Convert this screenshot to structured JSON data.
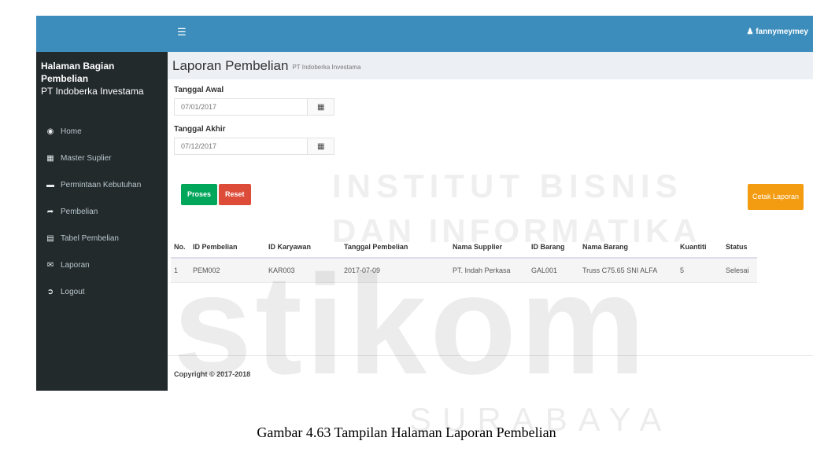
{
  "topbar": {
    "menu_icon": "hamburger-icon",
    "user_icon": "user-icon",
    "username": "fannymeymey"
  },
  "sidebar": {
    "title": "Halaman Bagian Pembelian",
    "subtitle": "PT Indoberka Investama",
    "items": [
      {
        "label": "Home",
        "icon": "dashboard-icon"
      },
      {
        "label": "Master Suplier",
        "icon": "grid-icon"
      },
      {
        "label": "Permintaan Kebutuhan",
        "icon": "folder-icon"
      },
      {
        "label": "Pembelian",
        "icon": "share-icon"
      },
      {
        "label": "Tabel Pembelian",
        "icon": "table-icon"
      },
      {
        "label": "Laporan",
        "icon": "envelope-icon"
      },
      {
        "label": "Logout",
        "icon": "logout-icon"
      }
    ]
  },
  "header": {
    "title": "Laporan Pembelian",
    "subtitle": "PT Indoberka Investama"
  },
  "form": {
    "start_label": "Tanggal Awal",
    "start_value": "07/01/2017",
    "end_label": "Tanggal Akhir",
    "end_value": "07/12/2017",
    "calendar_icon": "calendar-icon",
    "proses_label": "Proses",
    "reset_label": "Reset",
    "cetak_label": "Cetak Laporan"
  },
  "table": {
    "headers": [
      "No.",
      "ID Pembelian",
      "ID Karyawan",
      "Tanggal Pembelian",
      "Nama Supplier",
      "ID Barang",
      "Nama Barang",
      "Kuantiti",
      "Status"
    ],
    "rows": [
      [
        "1",
        "PEM002",
        "KAR003",
        "2017-07-09",
        "PT. Indah Perkasa",
        "GAL001",
        "Truss C75.65 SNI ALFA",
        "5",
        "Selesai"
      ]
    ]
  },
  "footer": {
    "copyright": "Copyright © 2017-2018"
  },
  "watermark": {
    "line1": "INSTITUT BISNIS",
    "line2": "DAN INFORMATIKA",
    "brand": "stikom",
    "city": "SURABAYA"
  },
  "caption": "Gambar 4.63 Tampilan Halaman Laporan Pembelian"
}
